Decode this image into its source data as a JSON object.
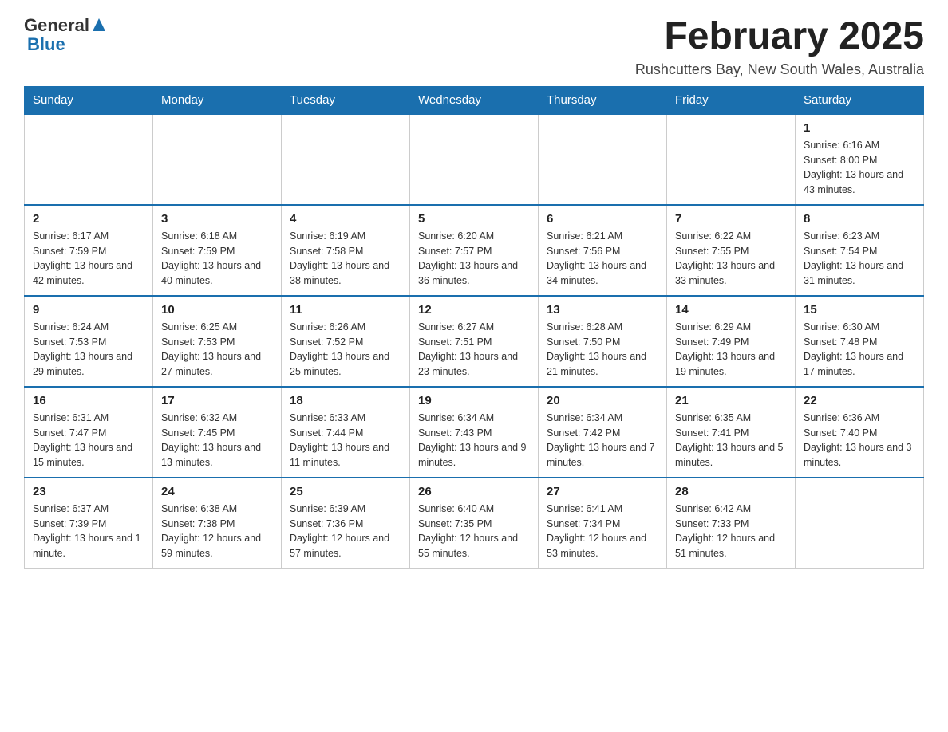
{
  "header": {
    "logo": {
      "text_general": "General",
      "text_blue": "Blue",
      "arrow_symbol": "▶"
    },
    "title": "February 2025",
    "location": "Rushcutters Bay, New South Wales, Australia"
  },
  "days_of_week": [
    "Sunday",
    "Monday",
    "Tuesday",
    "Wednesday",
    "Thursday",
    "Friday",
    "Saturday"
  ],
  "weeks": [
    {
      "days": [
        {
          "number": "",
          "info": ""
        },
        {
          "number": "",
          "info": ""
        },
        {
          "number": "",
          "info": ""
        },
        {
          "number": "",
          "info": ""
        },
        {
          "number": "",
          "info": ""
        },
        {
          "number": "",
          "info": ""
        },
        {
          "number": "1",
          "info": "Sunrise: 6:16 AM\nSunset: 8:00 PM\nDaylight: 13 hours and 43 minutes."
        }
      ]
    },
    {
      "days": [
        {
          "number": "2",
          "info": "Sunrise: 6:17 AM\nSunset: 7:59 PM\nDaylight: 13 hours and 42 minutes."
        },
        {
          "number": "3",
          "info": "Sunrise: 6:18 AM\nSunset: 7:59 PM\nDaylight: 13 hours and 40 minutes."
        },
        {
          "number": "4",
          "info": "Sunrise: 6:19 AM\nSunset: 7:58 PM\nDaylight: 13 hours and 38 minutes."
        },
        {
          "number": "5",
          "info": "Sunrise: 6:20 AM\nSunset: 7:57 PM\nDaylight: 13 hours and 36 minutes."
        },
        {
          "number": "6",
          "info": "Sunrise: 6:21 AM\nSunset: 7:56 PM\nDaylight: 13 hours and 34 minutes."
        },
        {
          "number": "7",
          "info": "Sunrise: 6:22 AM\nSunset: 7:55 PM\nDaylight: 13 hours and 33 minutes."
        },
        {
          "number": "8",
          "info": "Sunrise: 6:23 AM\nSunset: 7:54 PM\nDaylight: 13 hours and 31 minutes."
        }
      ]
    },
    {
      "days": [
        {
          "number": "9",
          "info": "Sunrise: 6:24 AM\nSunset: 7:53 PM\nDaylight: 13 hours and 29 minutes."
        },
        {
          "number": "10",
          "info": "Sunrise: 6:25 AM\nSunset: 7:53 PM\nDaylight: 13 hours and 27 minutes."
        },
        {
          "number": "11",
          "info": "Sunrise: 6:26 AM\nSunset: 7:52 PM\nDaylight: 13 hours and 25 minutes."
        },
        {
          "number": "12",
          "info": "Sunrise: 6:27 AM\nSunset: 7:51 PM\nDaylight: 13 hours and 23 minutes."
        },
        {
          "number": "13",
          "info": "Sunrise: 6:28 AM\nSunset: 7:50 PM\nDaylight: 13 hours and 21 minutes."
        },
        {
          "number": "14",
          "info": "Sunrise: 6:29 AM\nSunset: 7:49 PM\nDaylight: 13 hours and 19 minutes."
        },
        {
          "number": "15",
          "info": "Sunrise: 6:30 AM\nSunset: 7:48 PM\nDaylight: 13 hours and 17 minutes."
        }
      ]
    },
    {
      "days": [
        {
          "number": "16",
          "info": "Sunrise: 6:31 AM\nSunset: 7:47 PM\nDaylight: 13 hours and 15 minutes."
        },
        {
          "number": "17",
          "info": "Sunrise: 6:32 AM\nSunset: 7:45 PM\nDaylight: 13 hours and 13 minutes."
        },
        {
          "number": "18",
          "info": "Sunrise: 6:33 AM\nSunset: 7:44 PM\nDaylight: 13 hours and 11 minutes."
        },
        {
          "number": "19",
          "info": "Sunrise: 6:34 AM\nSunset: 7:43 PM\nDaylight: 13 hours and 9 minutes."
        },
        {
          "number": "20",
          "info": "Sunrise: 6:34 AM\nSunset: 7:42 PM\nDaylight: 13 hours and 7 minutes."
        },
        {
          "number": "21",
          "info": "Sunrise: 6:35 AM\nSunset: 7:41 PM\nDaylight: 13 hours and 5 minutes."
        },
        {
          "number": "22",
          "info": "Sunrise: 6:36 AM\nSunset: 7:40 PM\nDaylight: 13 hours and 3 minutes."
        }
      ]
    },
    {
      "days": [
        {
          "number": "23",
          "info": "Sunrise: 6:37 AM\nSunset: 7:39 PM\nDaylight: 13 hours and 1 minute."
        },
        {
          "number": "24",
          "info": "Sunrise: 6:38 AM\nSunset: 7:38 PM\nDaylight: 12 hours and 59 minutes."
        },
        {
          "number": "25",
          "info": "Sunrise: 6:39 AM\nSunset: 7:36 PM\nDaylight: 12 hours and 57 minutes."
        },
        {
          "number": "26",
          "info": "Sunrise: 6:40 AM\nSunset: 7:35 PM\nDaylight: 12 hours and 55 minutes."
        },
        {
          "number": "27",
          "info": "Sunrise: 6:41 AM\nSunset: 7:34 PM\nDaylight: 12 hours and 53 minutes."
        },
        {
          "number": "28",
          "info": "Sunrise: 6:42 AM\nSunset: 7:33 PM\nDaylight: 12 hours and 51 minutes."
        },
        {
          "number": "",
          "info": ""
        }
      ]
    }
  ]
}
